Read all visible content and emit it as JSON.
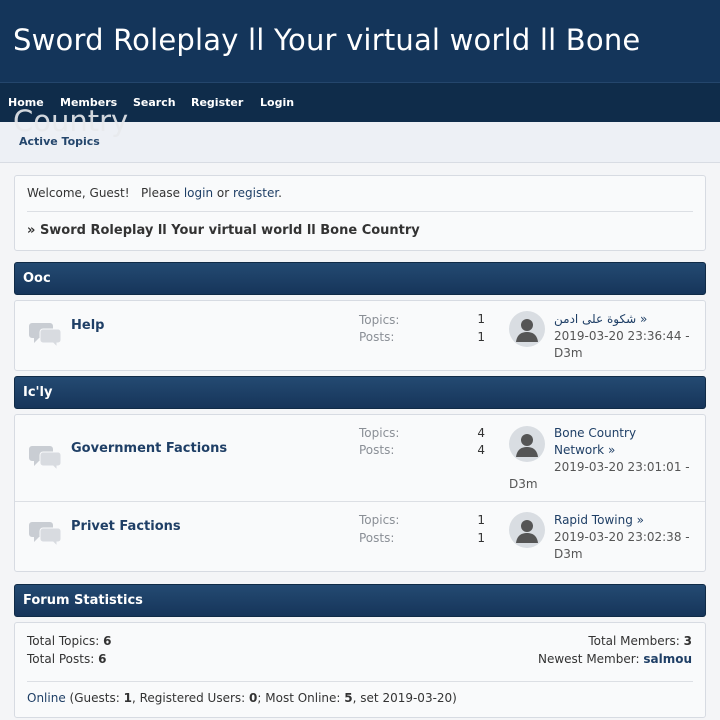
{
  "header": {
    "title": "Sword Roleplay ll Your virtual world ll Bone",
    "title_overflow": "Country"
  },
  "nav": [
    "Home",
    "Members",
    "Search",
    "Register",
    "Login"
  ],
  "subnav": {
    "active_topics": "Active Topics"
  },
  "welcome": {
    "greeting": "Welcome, Guest!",
    "please": "Please",
    "login": "login",
    "or": "or",
    "register": "register",
    "period": ".",
    "breadcrumb_prefix": "»",
    "breadcrumb": "Sword Roleplay ll Your virtual world ll Bone Country"
  },
  "categories": [
    {
      "name": "Ooc",
      "forums": [
        {
          "name": "Help",
          "topics_label": "Topics:",
          "topics": "1",
          "posts_label": "Posts:",
          "posts": "1",
          "last_post_title": "شكوة على ادمن",
          "last_post_arrow": "»",
          "last_post_date": "2019-03-20 23:36:44 -",
          "last_post_user": "D3m"
        }
      ]
    },
    {
      "name": "Ic'ly",
      "forums": [
        {
          "name": "Government Factions",
          "topics_label": "Topics:",
          "topics": "4",
          "posts_label": "Posts:",
          "posts": "4",
          "last_post_title_1": "Bone Country",
          "last_post_title_2": "Network",
          "last_post_arrow": "»",
          "last_post_date": "2019-03-20 23:01:01 -",
          "last_post_user": "D3m"
        },
        {
          "name": "Privet Factions",
          "topics_label": "Topics:",
          "topics": "1",
          "posts_label": "Posts:",
          "posts": "1",
          "last_post_title": "Rapid Towing",
          "last_post_arrow": "»",
          "last_post_date": "2019-03-20 23:02:38 -",
          "last_post_user": "D3m"
        }
      ]
    }
  ],
  "statistics": {
    "title": "Forum Statistics",
    "total_topics_label": "Total Topics:",
    "total_topics": "6",
    "total_posts_label": "Total Posts:",
    "total_posts": "6",
    "total_members_label": "Total Members:",
    "total_members": "3",
    "newest_member_label": "Newest Member:",
    "newest_member": "salmou",
    "online_link": "Online",
    "guests_label": "(Guests:",
    "guests": "1",
    "registered_label": ", Registered Users:",
    "registered": "0",
    "most_online_label": "; Most Online:",
    "most_online": "5",
    "most_online_date": ", set 2019-03-20)"
  },
  "icons": {
    "forum": "forum-bubbles-icon",
    "avatar": "default-user-avatar-icon"
  },
  "colors": {
    "header_bg": "#14355a",
    "nav_bg": "#0f2c4a",
    "category_bar": "#1d4068",
    "link": "#1f3f66"
  }
}
